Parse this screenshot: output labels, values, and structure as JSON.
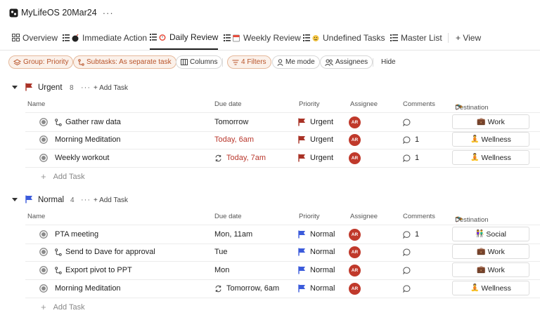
{
  "app": {
    "title": "MyLifeOS 20Mar24",
    "more": "···"
  },
  "tabs": [
    {
      "label": "Overview",
      "icon": "grid-icon"
    },
    {
      "label": "Immediate Action",
      "icon": "list-bomb-icon"
    },
    {
      "label": "Daily Review",
      "icon": "list-alarm-icon",
      "active": true
    },
    {
      "label": "Weekly Review",
      "icon": "list-calendar-icon"
    },
    {
      "label": "Undefined Tasks",
      "icon": "list-smiley-icon"
    },
    {
      "label": "Master List",
      "icon": "list-icon"
    },
    {
      "label": "+ View",
      "icon": "plus-icon"
    }
  ],
  "toolbar": {
    "group": "Group: Priority",
    "subtasks": "Subtasks: As separate task",
    "columns": "Columns",
    "filters": "4 Filters",
    "me_mode": "Me mode",
    "assignees": "Assignees",
    "hide": "Hide"
  },
  "columns": {
    "name": "Name",
    "due": "Due date",
    "priority": "Priority",
    "assignee": "Assignee",
    "comments": "Comments",
    "destination": "Destination"
  },
  "groups": [
    {
      "name": "Urgent",
      "count": "8",
      "more": "···",
      "add": "+ Add Task",
      "flag_color": "#a93226",
      "tasks": [
        {
          "name": "Gather raw data",
          "subtask": true,
          "due": "Tomorrow",
          "due_red": false,
          "recurring": false,
          "priority": "Urgent",
          "assignee": "AR",
          "comments": "",
          "destination": "Work",
          "dest_emoji": "💼"
        },
        {
          "name": "Morning Meditation",
          "subtask": false,
          "due": "Today, 6am",
          "due_red": true,
          "recurring": false,
          "priority": "Urgent",
          "assignee": "AR",
          "comments": "1",
          "destination": "Wellness",
          "dest_emoji": "🧘"
        },
        {
          "name": "Weekly workout",
          "subtask": false,
          "due": "Today, 7am",
          "due_red": true,
          "recurring": true,
          "priority": "Urgent",
          "assignee": "AR",
          "comments": "1",
          "destination": "Wellness",
          "dest_emoji": "🧘"
        }
      ],
      "add_task": "Add Task"
    },
    {
      "name": "Normal",
      "count": "4",
      "more": "···",
      "add": "+ Add Task",
      "flag_color": "#3b5bdb",
      "tasks": [
        {
          "name": "PTA meeting",
          "subtask": false,
          "due": "Mon, 11am",
          "due_red": false,
          "recurring": false,
          "priority": "Normal",
          "assignee": "AR",
          "comments": "1",
          "destination": "Social",
          "dest_emoji": "👫"
        },
        {
          "name": "Send to Dave for approval",
          "subtask": true,
          "due": "Tue",
          "due_red": false,
          "recurring": false,
          "priority": "Normal",
          "assignee": "AR",
          "comments": "",
          "destination": "Work",
          "dest_emoji": "💼"
        },
        {
          "name": "Export pivot to PPT",
          "subtask": true,
          "due": "Mon",
          "due_red": false,
          "recurring": false,
          "priority": "Normal",
          "assignee": "AR",
          "comments": "",
          "destination": "Work",
          "dest_emoji": "💼"
        },
        {
          "name": "Morning Meditation",
          "subtask": false,
          "due": "Tomorrow, 6am",
          "due_red": false,
          "recurring": true,
          "priority": "Normal",
          "assignee": "AR",
          "comments": "",
          "destination": "Wellness",
          "dest_emoji": "🧘"
        }
      ],
      "add_task": "Add Task"
    }
  ],
  "colors": {
    "urgent": "#a93226",
    "normal": "#3b5bdb",
    "accent": "#b8542a",
    "avatar": "#c0392b",
    "due_red": "#b9382d"
  }
}
